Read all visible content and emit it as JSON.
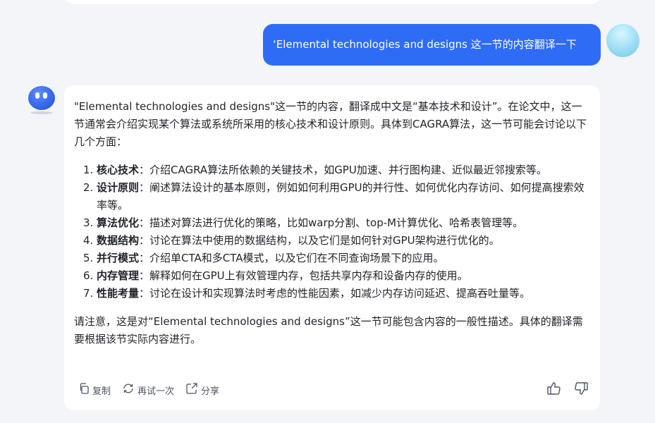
{
  "user_message": {
    "text": "‘Elemental technologies and designs 这一节的内容翻译一下"
  },
  "assistant": {
    "intro": "\"Elemental technologies and designs\"这一节的内容，翻译成中文是“基本技术和设计”。在论文中，这一节通常会介绍实现某个算法或系统所采用的核心技术和设计原则。具体到CAGRA算法，这一节可能会讨论以下几个方面：",
    "items": [
      {
        "num": "1.",
        "term": "核心技术",
        "desc": "：介绍CAGRA算法所依赖的关键技术，如GPU加速、并行图构建、近似最近邻搜索等。"
      },
      {
        "num": "2.",
        "term": "设计原则",
        "desc": "：阐述算法设计的基本原则，例如如何利用GPU的并行性、如何优化内存访问、如何提高搜索效率等。"
      },
      {
        "num": "3.",
        "term": "算法优化",
        "desc": "：描述对算法进行优化的策略，比如warp分割、top-M计算优化、哈希表管理等。"
      },
      {
        "num": "4.",
        "term": "数据结构",
        "desc": "：讨论在算法中使用的数据结构，以及它们是如何针对GPU架构进行优化的。"
      },
      {
        "num": "5.",
        "term": "并行模式",
        "desc": "：介绍单CTA和多CTA模式，以及它们在不同查询场景下的应用。"
      },
      {
        "num": "6.",
        "term": "内存管理",
        "desc": "：解释如何在GPU上有效管理内存，包括共享内存和设备内存的使用。"
      },
      {
        "num": "7.",
        "term": "性能考量",
        "desc": "：讨论在设计和实现算法时考虑的性能因素，如减少内存访问延迟、提高吞吐量等。"
      }
    ],
    "outro": "请注意，这是对“Elemental technologies and designs”这一节可能包含内容的一般性描述。具体的翻译需要根据该节实际内容进行。"
  },
  "actions": {
    "copy": "复制",
    "retry": "再试一次",
    "share": "分享"
  },
  "icons": [
    "copy-icon",
    "retry-icon",
    "share-icon",
    "thumbs-up-icon",
    "thumbs-down-icon"
  ],
  "colors": {
    "accent": "#2f6cf6",
    "background": "#f4f5f9",
    "card": "#ffffff"
  }
}
